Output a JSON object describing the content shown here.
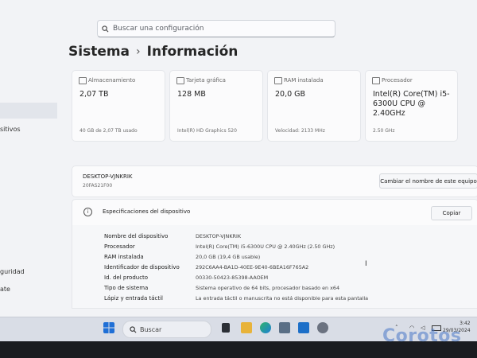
{
  "search": {
    "placeholder": "Buscar una configuración"
  },
  "sidebar": {
    "items": [
      "sitivos",
      "guridad",
      "ate"
    ]
  },
  "breadcrumb": {
    "parent": "Sistema",
    "separator": "›",
    "current": "Información"
  },
  "cards": [
    {
      "label": "Almacenamiento",
      "value": "2,07 TB",
      "sub": "40 GB de 2,07 TB usado",
      "icon": "storage-icon"
    },
    {
      "label": "Tarjeta gráfica",
      "value": "128 MB",
      "sub": "Intel(R) HD Graphics 520",
      "icon": "gpu-icon"
    },
    {
      "label": "RAM instalada",
      "value": "20,0 GB",
      "sub": "Velocidad: 2133 MHz",
      "icon": "ram-icon"
    },
    {
      "label": "Procesador",
      "value": "Intel(R) Core(TM) i5-6300U CPU @ 2.40GHz",
      "sub": "2.50 GHz",
      "icon": "cpu-icon"
    }
  ],
  "device": {
    "name": "DESKTOP-VJNKRIK",
    "model": "20FAS21F00",
    "rename_label": "Cambiar el nombre de este equipo"
  },
  "specs": {
    "title": "Especificaciones del dispositivo",
    "copy_label": "Copiar",
    "rows": [
      {
        "label": "Nombre del dispositivo",
        "value": "DESKTOP-VJNKRIK"
      },
      {
        "label": "Procesador",
        "value": "Intel(R) Core(TM) i5-6300U CPU @ 2.40GHz (2.50 GHz)"
      },
      {
        "label": "RAM instalada",
        "value": "20,0 GB (19,4 GB usable)"
      },
      {
        "label": "Identificador de dispositivo",
        "value": "292C6AA4-BA1D-40EE-9E40-6BEA16F765A2"
      },
      {
        "label": "Id. del producto",
        "value": "00330-50423-85398-AAOEM"
      },
      {
        "label": "Tipo de sistema",
        "value": "Sistema operativo de 64 bits, procesador basado en x64"
      },
      {
        "label": "Lápiz y entrada táctil",
        "value": "La entrada táctil o manuscrita no está disponible para esta pantalla"
      }
    ]
  },
  "taskbar": {
    "search_label": "Buscar",
    "time": "3:42",
    "date": "29/03/2024"
  },
  "watermark": "Corotos"
}
